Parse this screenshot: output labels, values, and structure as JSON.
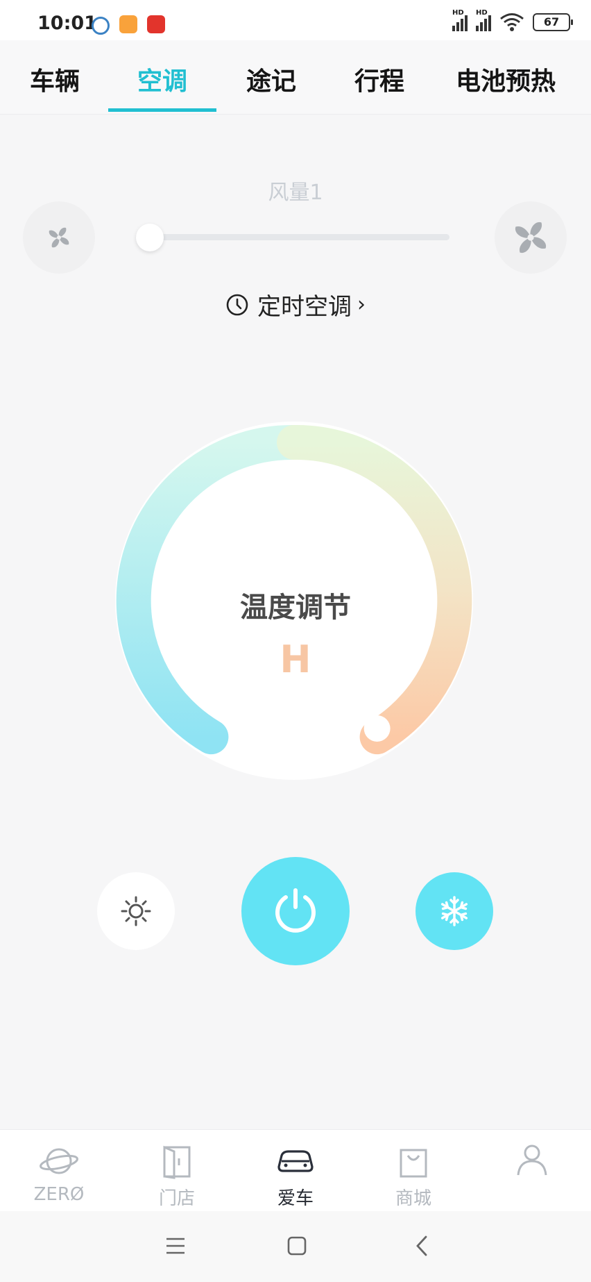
{
  "status_bar": {
    "time": "10:01",
    "signal_labels": [
      "HD",
      "HD"
    ],
    "battery_level": "67",
    "app_icons": [
      "blue-circle-app-icon",
      "orange-app-icon",
      "red-app-icon"
    ]
  },
  "tabs": [
    {
      "label": "车辆",
      "active": false
    },
    {
      "label": "空调",
      "active": true
    },
    {
      "label": "途记",
      "active": false
    },
    {
      "label": "行程",
      "active": false
    },
    {
      "label": "电池预热",
      "active": false
    }
  ],
  "fan": {
    "label": "风量1",
    "level_fraction": 0.0
  },
  "timer": {
    "label": "定时空调",
    "arrow": "›"
  },
  "dial": {
    "title": "温度调节",
    "value": "H",
    "position_fraction": 1.0
  },
  "controls": {
    "heat_icon": "sun-icon",
    "power_icon": "power-icon",
    "cool_icon": "snowflake-icon"
  },
  "bottom_nav": [
    {
      "label": "ZERØ",
      "icon": "planet-icon",
      "active": false
    },
    {
      "label": "门店",
      "icon": "store-door-icon",
      "active": false
    },
    {
      "label": "爱车",
      "icon": "car-icon",
      "active": true
    },
    {
      "label": "商城",
      "icon": "shopping-bag-icon",
      "active": false
    },
    {
      "label": "",
      "icon": "user-icon",
      "active": false
    }
  ],
  "colors": {
    "accent": "#21bfd1",
    "button_cyan": "#62e3f4",
    "dial_warm": "#f7c6a4"
  }
}
